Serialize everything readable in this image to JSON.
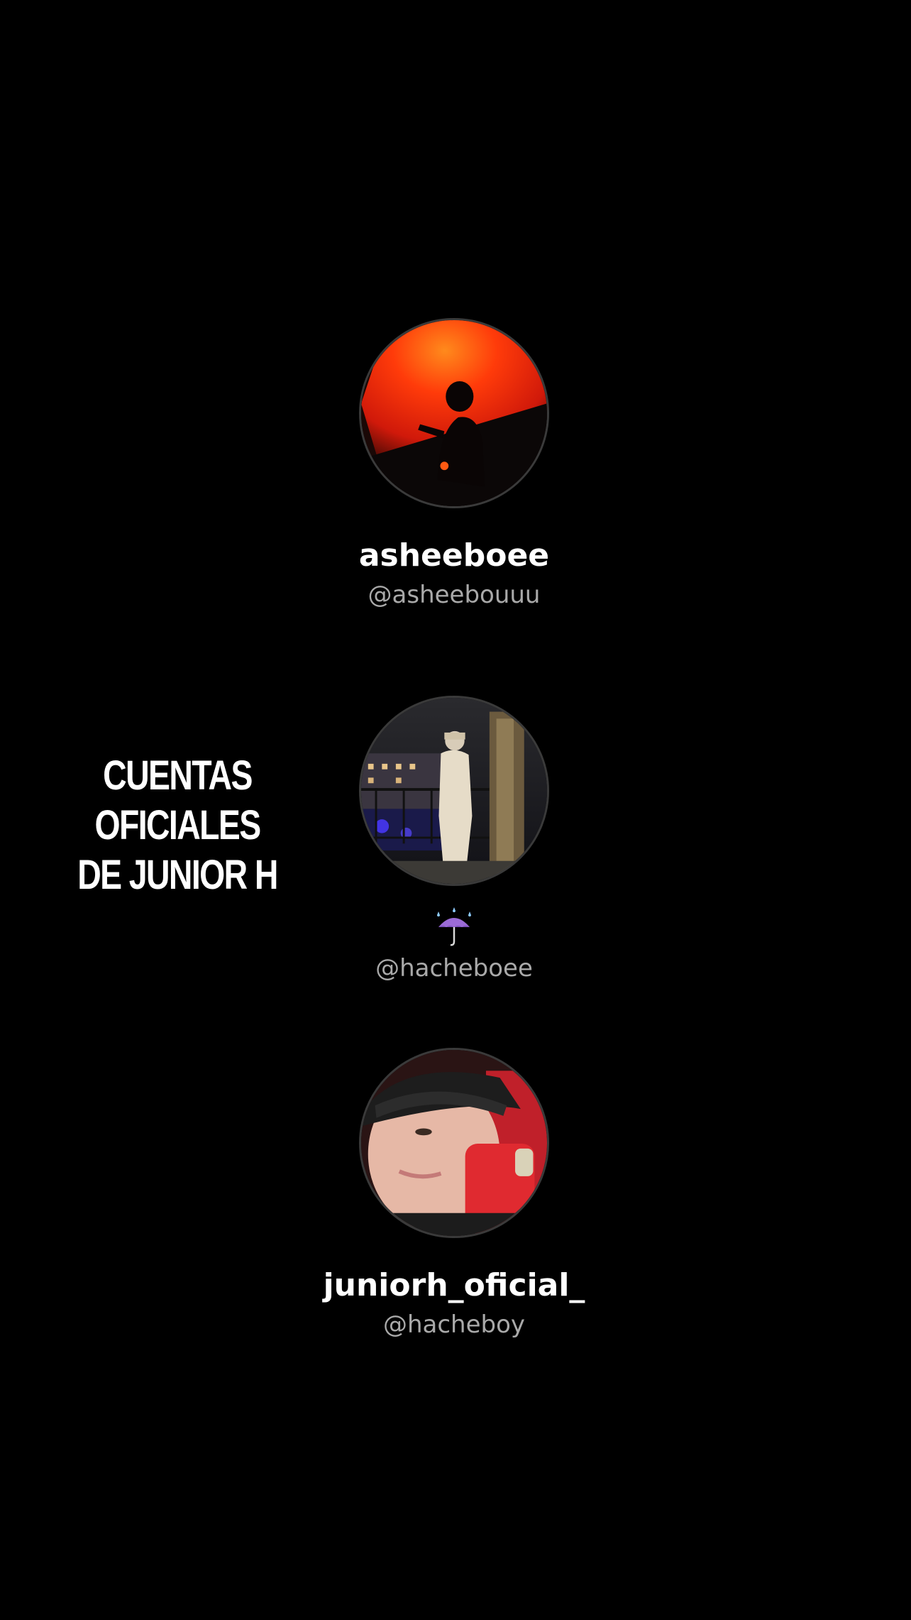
{
  "headline": {
    "line1": "CUENTAS OFICIALES",
    "line2": "DE JUNIOR H"
  },
  "profiles": [
    {
      "display_name": "asheeboee",
      "handle": "@asheebouuu",
      "avatar": "silhouette-red-concert-photo"
    },
    {
      "display_name": "☔",
      "handle": "@hacheboee",
      "avatar": "balcony-night-city-photo"
    },
    {
      "display_name": "juniorh_oficial_",
      "handle": "@hacheboy",
      "avatar": "cap-selfie-car-photo"
    }
  ],
  "colors": {
    "background": "#000000",
    "text_primary": "#ffffff",
    "text_secondary": "#a9a9a9",
    "avatar_border": "#3a3a3a",
    "umbrella_purple": "#9b6bd6"
  }
}
